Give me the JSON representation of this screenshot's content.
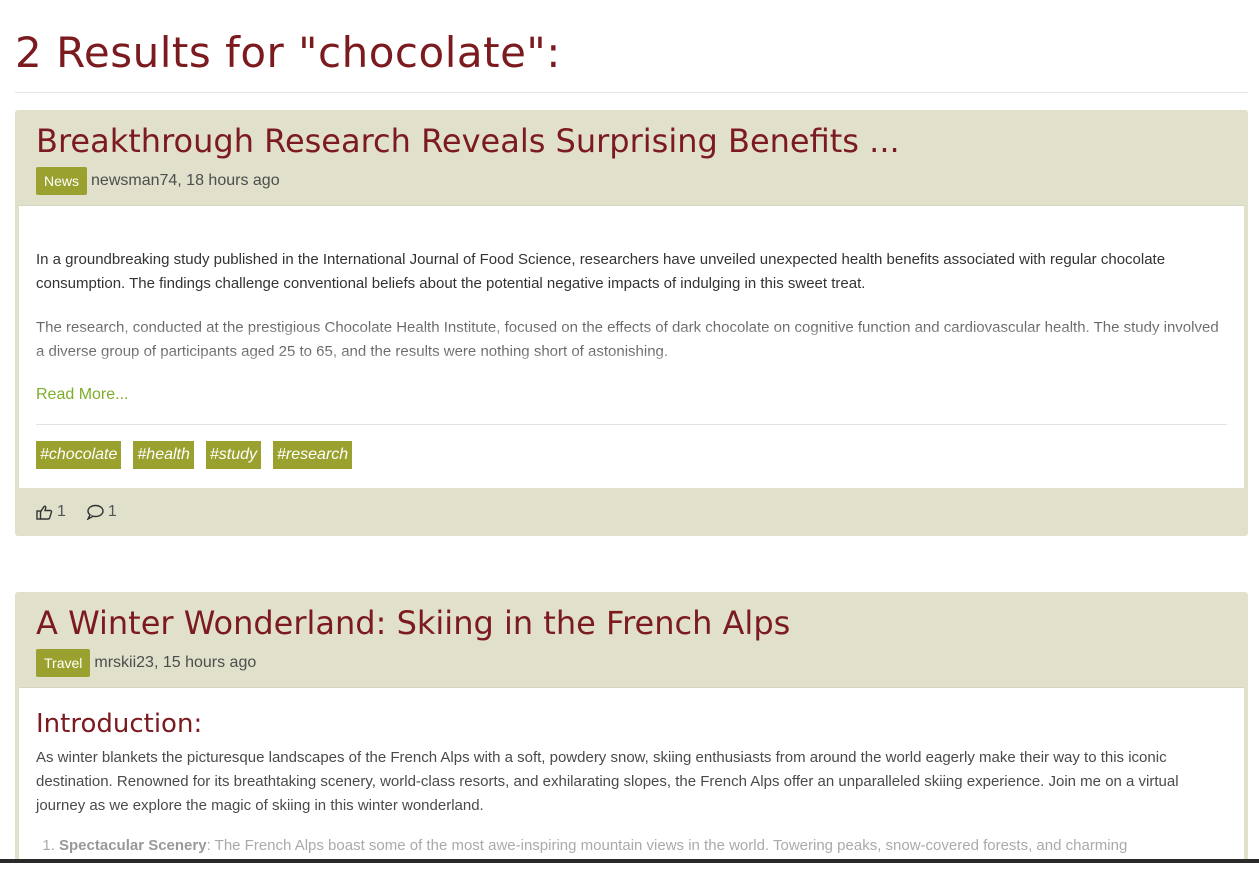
{
  "results_heading": "2 Results for \"chocolate\":",
  "posts": [
    {
      "title": "Breakthrough Research Reveals Surprising Benefits ...",
      "category": "News",
      "byline": "newsman74, 18 hours ago",
      "paragraphs": [
        "In a groundbreaking study published in the International Journal of Food Science, researchers have unveiled unexpected health benefits associated with regular chocolate consumption. The findings challenge conventional beliefs about the potential negative impacts of indulging in this sweet treat.",
        "The research, conducted at the prestigious Chocolate Health Institute, focused on the effects of dark chocolate on cognitive function and cardiovascular health. The study involved a diverse group of participants aged 25 to 65, and the results were nothing short of astonishing."
      ],
      "read_more": "Read More...",
      "tags": [
        "#chocolate",
        "#health",
        "#study",
        "#research"
      ],
      "likes": "1",
      "comments": "1"
    },
    {
      "title": "A Winter Wonderland: Skiing in the French Alps",
      "category": "Travel",
      "byline": "mrskii23, 15 hours ago",
      "section_heading": "Introduction:",
      "paragraphs": [
        "As winter blankets the picturesque landscapes of the French Alps with a soft, powdery snow, skiing enthusiasts from around the world eagerly make their way to this iconic destination. Renowned for its breathtaking scenery, world-class resorts, and exhilarating slopes, the French Alps offer an unparalleled skiing experience. Join me on a virtual journey as we explore the magic of skiing in this winter wonderland."
      ],
      "list_items": [
        {
          "label": "Spectacular Scenery",
          "text": ": The French Alps boast some of the most awe-inspiring mountain views in the world. Towering peaks, snow-covered forests, and charming"
        }
      ]
    }
  ],
  "colors": {
    "title": "#7b1a1f",
    "card_bg": "#e1e0cb",
    "badge": "#9aa12f",
    "link": "#7cae2b"
  },
  "icons": {
    "like": "thumbs-up-icon",
    "comment": "comment-bubble-icon"
  }
}
